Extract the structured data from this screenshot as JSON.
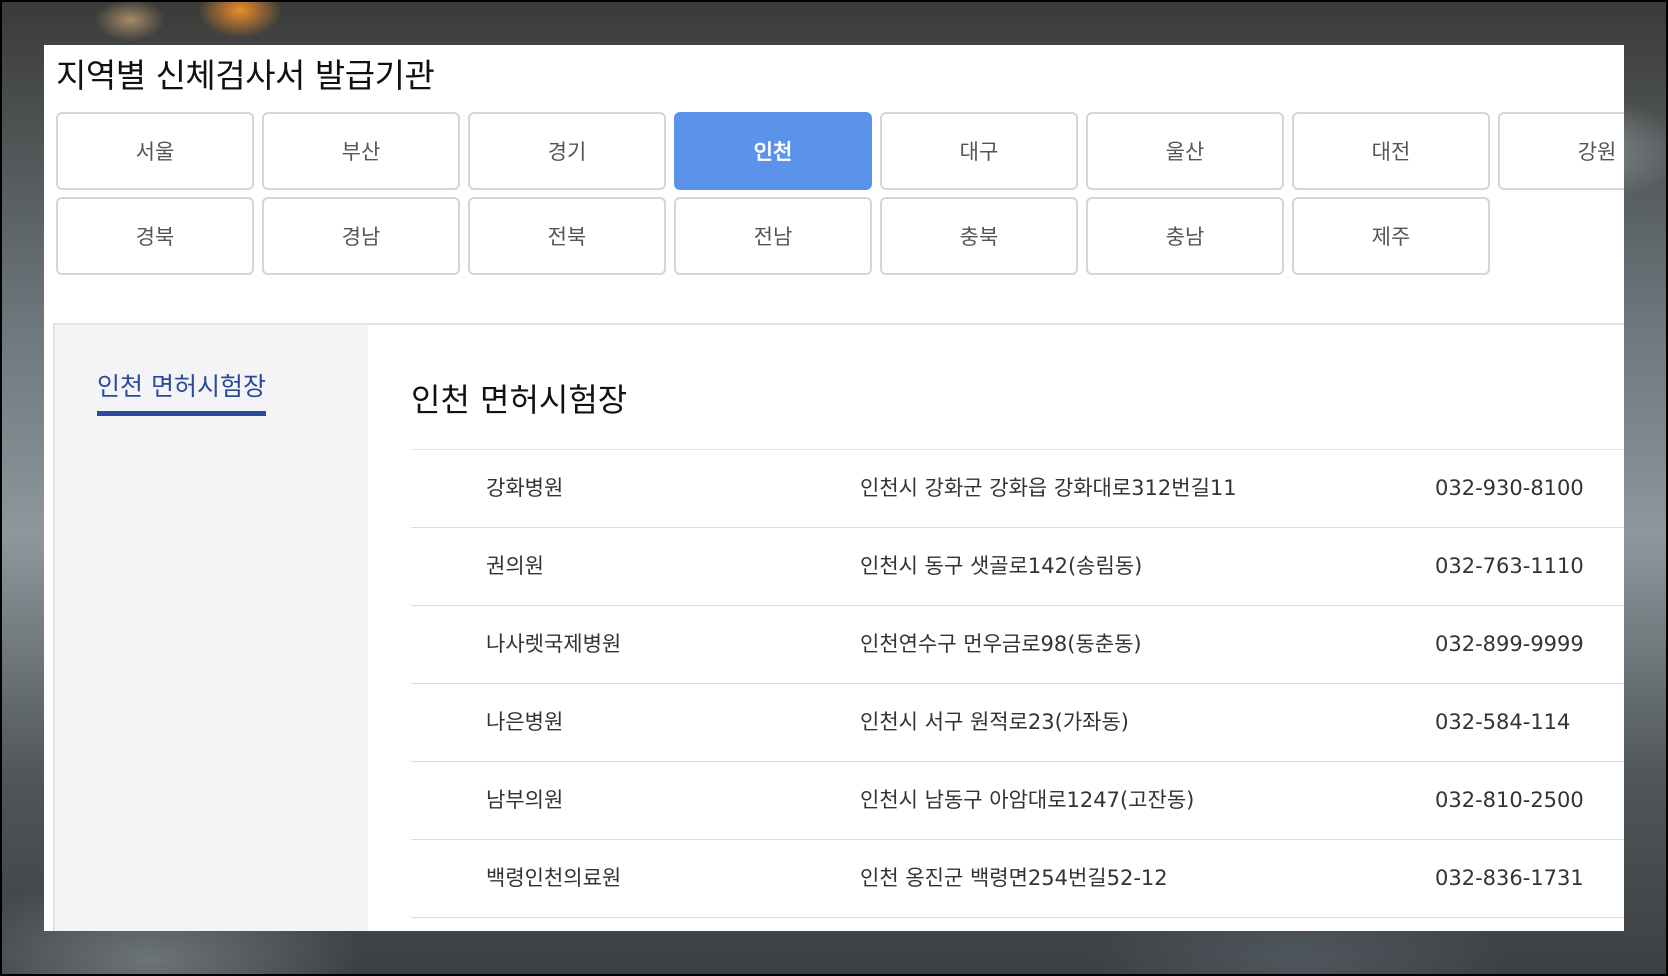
{
  "page": {
    "title": "지역별 신체검사서 발급기관"
  },
  "regions": {
    "row1": [
      "서울",
      "부산",
      "경기",
      "인천",
      "대구",
      "울산",
      "대전",
      "강원"
    ],
    "row2": [
      "경북",
      "경남",
      "전북",
      "전남",
      "충북",
      "충남",
      "제주"
    ],
    "selected": "인천"
  },
  "sidebar": {
    "items": [
      {
        "label": "인천 면허시험장",
        "active": true
      }
    ]
  },
  "section": {
    "title": "인천 면허시험장"
  },
  "institutions": [
    {
      "name": "강화병원",
      "address": "인천시 강화군 강화읍 강화대로312번길11",
      "phone": "032-930-8100"
    },
    {
      "name": "권의원",
      "address": "인천시 동구 샛골로142(송림동)",
      "phone": "032-763-1110"
    },
    {
      "name": "나사렛국제병원",
      "address": "인천연수구 먼우금로98(동춘동)",
      "phone": "032-899-9999"
    },
    {
      "name": "나은병원",
      "address": "인천시 서구 원적로23(가좌동)",
      "phone": "032-584-114"
    },
    {
      "name": "남부의원",
      "address": "인천시 남동구 아암대로1247(고잔동)",
      "phone": "032-810-2500"
    },
    {
      "name": "백령인천의료원",
      "address": "인천 옹진군 백령면254번길52-12",
      "phone": "032-836-1731"
    }
  ],
  "colors": {
    "accent": "#5b93ea",
    "sidebar_active": "#2a4b9b"
  }
}
